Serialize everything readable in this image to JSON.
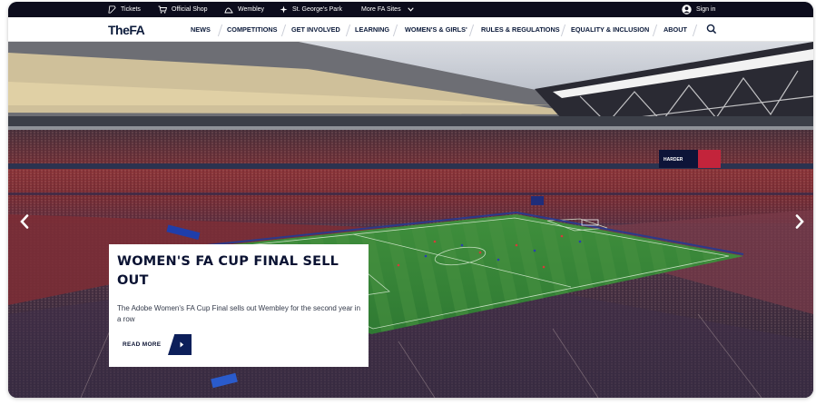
{
  "utility_bar": {
    "tickets": "Tickets",
    "official_shop": "Official Shop",
    "wembley": "Wembley",
    "st_georges_park": "St. George's Park",
    "more_sites": "More FA Sites",
    "sign_in": "Sign in",
    "icons": [
      "ticket-icon",
      "shop-icon",
      "wembley-arch-icon",
      "st-georges-park-icon",
      "chevron-down-icon",
      "user-icon"
    ]
  },
  "nav": {
    "logo": "TheFA",
    "items": [
      "NEWS",
      "COMPETITIONS",
      "GET INVOLVED",
      "LEARNING",
      "WOMEN'S & GIRLS'",
      "RULES & REGULATIONS",
      "EQUALITY & INCLUSION",
      "ABOUT"
    ],
    "search_icon": "search-icon"
  },
  "hero": {
    "title": "WOMEN'S FA CUP FINAL SELL OUT",
    "description": "The Adobe Women's FA Cup Final sells out Wembley for the second year in a row",
    "read_more": "READ MORE",
    "big_screen_text": "HARDER",
    "icons": [
      "chevron-left-icon",
      "chevron-right-icon",
      "arrow-right-icon"
    ]
  },
  "colors": {
    "utility_bg": "#0c0c1c",
    "navy": "#0a1232",
    "accent_blue": "#0c1f5a",
    "pitch": "#3b8a3a",
    "crowd_red": "#8a2e33"
  }
}
